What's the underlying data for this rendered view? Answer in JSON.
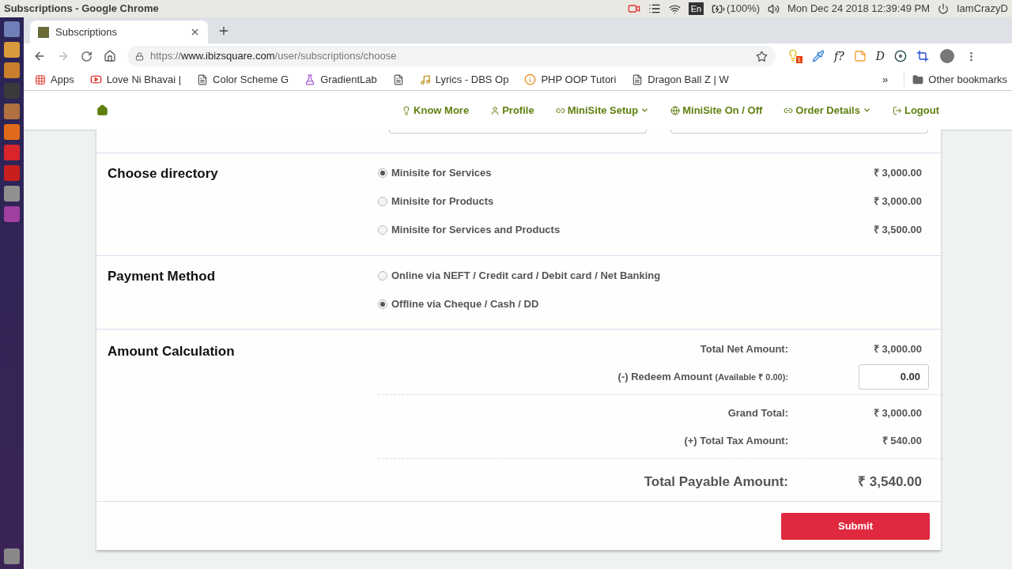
{
  "os_bar": {
    "title": "Subscriptions - Google Chrome",
    "input_method": "En",
    "battery": "(100%)",
    "clock": "Mon Dec 24 2018 12:39:49 PM",
    "user": "IamCrazyD"
  },
  "browser": {
    "tab": {
      "title": "Subscriptions"
    },
    "url": {
      "scheme": "https://",
      "host": "www.ibizsquare.com",
      "path": "/user/subscriptions/choose"
    },
    "extensions": [
      {
        "kind": "bulb",
        "badge": "1"
      },
      {
        "kind": "dropper"
      },
      {
        "kind": "text",
        "text": "f?"
      },
      {
        "kind": "note"
      },
      {
        "kind": "text",
        "text": "D"
      },
      {
        "kind": "disc"
      },
      {
        "kind": "crop"
      }
    ],
    "bookmarks": [
      {
        "kind": "apps",
        "label": "Apps"
      },
      {
        "kind": "video",
        "label": "Love Ni Bhavai |"
      },
      {
        "kind": "page",
        "label": "Color Scheme G"
      },
      {
        "kind": "flask",
        "label": "GradientLab"
      },
      {
        "kind": "page"
      },
      {
        "kind": "lyrics",
        "label": "Lyrics - DBS Op"
      },
      {
        "kind": "php",
        "label": "PHP OOP Tutori"
      },
      {
        "kind": "page",
        "label": "Dragon Ball Z | W"
      }
    ],
    "more": "»",
    "other_bookmarks": "Other bookmarks"
  },
  "nav": [
    {
      "kind": "bulb",
      "label": "Know More",
      "has_menu": false
    },
    {
      "kind": "user",
      "label": "Profile",
      "has_menu": false
    },
    {
      "kind": "link",
      "label": "MiniSite Setup",
      "has_menu": true
    },
    {
      "kind": "globe",
      "label": "MiniSite On / Off",
      "has_menu": false
    },
    {
      "kind": "link",
      "label": "Order Details",
      "has_menu": true
    },
    {
      "kind": "logout",
      "label": "Logout",
      "has_menu": false
    }
  ],
  "directory": {
    "title": "Choose directory",
    "options": [
      {
        "label": "Minisite for Services",
        "price": "₹ 3,000.00",
        "selected": true
      },
      {
        "label": "Minisite for Products",
        "price": "₹ 3,000.00",
        "selected": false
      },
      {
        "label": "Minisite for Services and Products",
        "price": "₹ 3,500.00",
        "selected": false
      }
    ]
  },
  "payment": {
    "title": "Payment Method",
    "options": [
      {
        "label": "Online via NEFT / Credit card / Debit card / Net Banking",
        "selected": false
      },
      {
        "label": "Offline via Cheque / Cash / DD",
        "selected": true
      }
    ]
  },
  "amount": {
    "title": "Amount Calculation",
    "rows": [
      {
        "kind": "value",
        "label": "Total Net Amount:",
        "value": "₹ 3,000.00"
      },
      {
        "kind": "input",
        "label": "(-) Redeem Amount",
        "note": "(Available ₹ 0.00):",
        "value": "0.00"
      },
      {
        "kind": "separator"
      },
      {
        "kind": "value",
        "label": "Grand Total:",
        "value": "₹ 3,000.00"
      },
      {
        "kind": "value",
        "label": "(+) Total Tax Amount:",
        "value": "₹ 540.00"
      },
      {
        "kind": "separator"
      },
      {
        "kind": "total",
        "label": "Total Payable Amount:",
        "value": "₹ 3,540.00"
      }
    ]
  },
  "submit": "Submit"
}
